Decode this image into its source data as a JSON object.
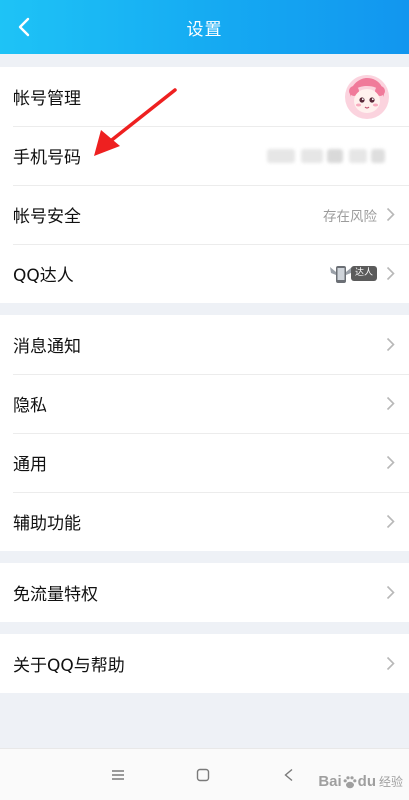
{
  "header": {
    "title": "设置",
    "back_icon": "chevron-left-icon",
    "background": "#15a9f2"
  },
  "groups": [
    {
      "items": [
        {
          "label": "帐号管理",
          "right": "avatar"
        },
        {
          "label": "手机号码",
          "right": "blurred-value"
        },
        {
          "label": "帐号安全",
          "sub": "存在风险",
          "right": "chevron"
        },
        {
          "label": "QQ达人",
          "badge": "达人",
          "right": "chevron"
        }
      ]
    },
    {
      "items": [
        {
          "label": "消息通知",
          "right": "chevron"
        },
        {
          "label": "隐私",
          "right": "chevron"
        },
        {
          "label": "通用",
          "right": "chevron"
        },
        {
          "label": "辅助功能",
          "right": "chevron"
        }
      ]
    },
    {
      "items": [
        {
          "label": "免流量特权",
          "right": "chevron"
        }
      ]
    },
    {
      "items": [
        {
          "label": "关于QQ与帮助",
          "right": "chevron"
        }
      ]
    }
  ],
  "annotation": {
    "color": "#ee2020",
    "points_to": "手机号码"
  },
  "navbar": {
    "icons": [
      "menu-icon",
      "home-square-icon",
      "back-triangle-icon"
    ]
  },
  "watermark": {
    "brand": "Bai",
    "paw": "du",
    "suffix": "经验"
  },
  "colors": {
    "page_bg": "#eef1f6",
    "divider": "#ececec",
    "sub_text": "#9c9c9c",
    "chevron": "#b8b8b8"
  }
}
